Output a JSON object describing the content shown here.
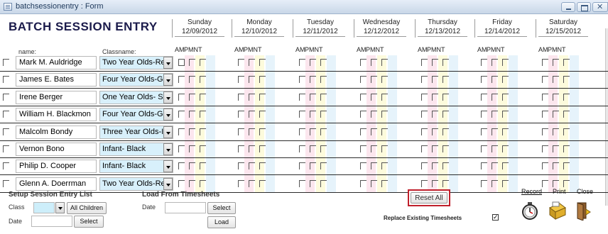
{
  "window": {
    "title": "batchsessionentry : Form"
  },
  "form": {
    "title": "BATCH SESSION ENTRY",
    "col_name": "name:",
    "col_class": "Classname:"
  },
  "days": [
    {
      "name": "Sunday",
      "date": "12/09/2012"
    },
    {
      "name": "Monday",
      "date": "12/10/2012"
    },
    {
      "name": "Tuesday",
      "date": "12/11/2012"
    },
    {
      "name": "Wednesday",
      "date": "12/12/2012"
    },
    {
      "name": "Thursday",
      "date": "12/13/2012"
    },
    {
      "name": "Friday",
      "date": "12/14/2012"
    },
    {
      "name": "Saturday",
      "date": "12/15/2012"
    }
  ],
  "period_labels": {
    "am": "AM",
    "pm": "PM",
    "nt": "NT"
  },
  "rows": [
    {
      "name": "Mark M. Auldridge",
      "classname": "Two Year Olds-Re"
    },
    {
      "name": "James E. Bates",
      "classname": "Four Year Olds-G"
    },
    {
      "name": "Irene Berger",
      "classname": "One Year Olds- S"
    },
    {
      "name": "William H. Blackmon",
      "classname": "Four Year Olds-G"
    },
    {
      "name": "Malcolm Bondy",
      "classname": "Three Year Olds-I"
    },
    {
      "name": "Vernon Bono",
      "classname": "Infant- Black"
    },
    {
      "name": "Philip D. Cooper",
      "classname": "Infant- Black"
    },
    {
      "name": "Glenn A. Doerrman",
      "classname": "Two Year Olds-Re"
    }
  ],
  "setup": {
    "title": "Setup Session Entry List",
    "class_label": "Class",
    "class_value": "",
    "all_children_label": "All Children",
    "date_label": "Date",
    "date_value": "",
    "select_label": "Select"
  },
  "load": {
    "title": "Load From Timesheets",
    "date_label": "Date",
    "date_value": "",
    "select_label": "Select",
    "load_label": "Load"
  },
  "actions": {
    "reset_all_label": "Reset All",
    "replace_label": "Replace Existing Timesheets",
    "replace_checked": true,
    "record_label": "Record",
    "print_label": "Print",
    "close_label": "Close"
  },
  "colors": {
    "accent_red": "#c0202c",
    "selected_field": "#d8f0fb"
  }
}
